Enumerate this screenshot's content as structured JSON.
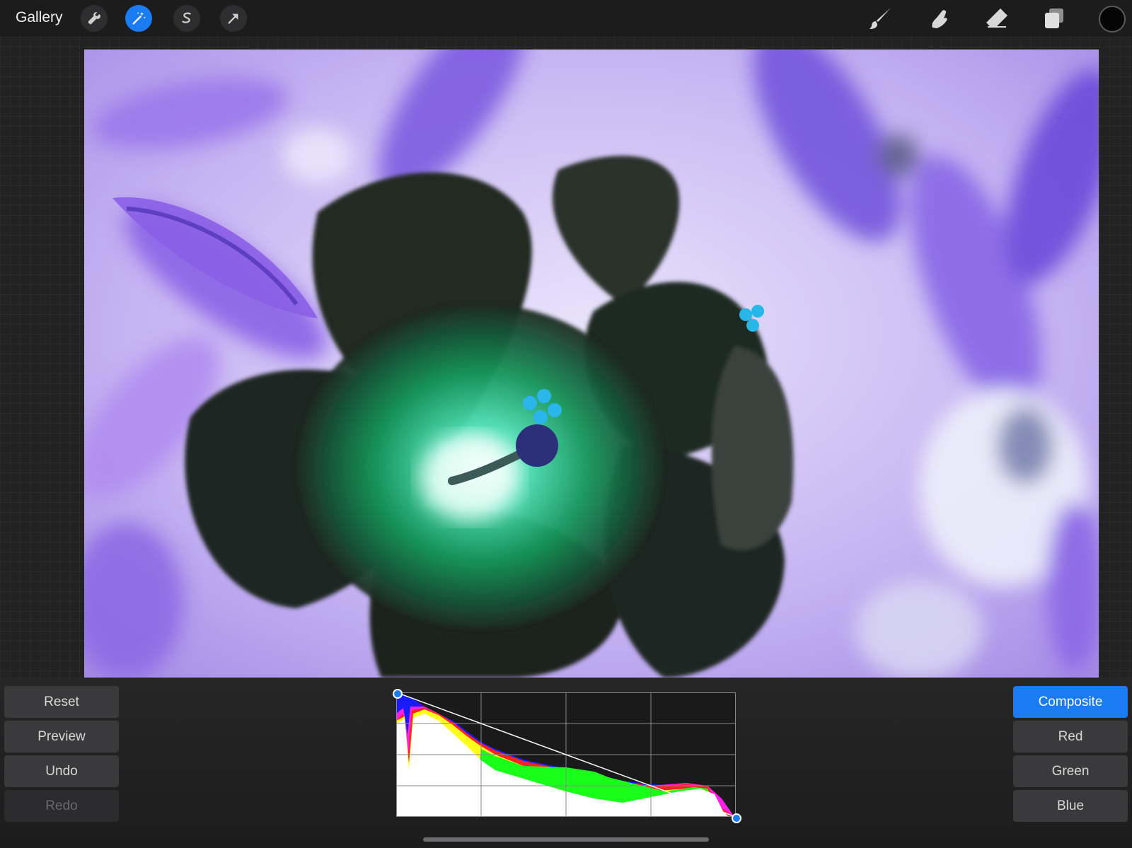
{
  "topbar": {
    "gallery_label": "Gallery",
    "left_tools": [
      "wrench-icon",
      "magic-wand-icon",
      "selection-icon",
      "transform-arrow-icon"
    ],
    "active_tool": "magic-wand-icon",
    "right_tools": [
      "brush-icon",
      "smudge-icon",
      "eraser-icon",
      "layers-icon"
    ],
    "current_color": "#050505",
    "accent_color": "#1a7cf5"
  },
  "canvas": {
    "description_colors": [
      "#b39af0",
      "#6b4fe0",
      "#e8e2f8",
      "#1f2a22",
      "#22c983"
    ]
  },
  "left_buttons": {
    "reset": "Reset",
    "preview": "Preview",
    "undo": "Undo",
    "redo": "Redo"
  },
  "channel_buttons": {
    "composite": "Composite",
    "red": "Red",
    "green": "Green",
    "blue": "Blue",
    "selected": "Composite"
  },
  "curves": {
    "mode": "inverted",
    "points": [
      [
        0,
        255
      ],
      [
        255,
        0
      ]
    ],
    "histogram_colors": [
      "#0000ff",
      "#ff00ff",
      "#ff0000",
      "#ffff00",
      "#00ff00",
      "#ffffff"
    ]
  }
}
